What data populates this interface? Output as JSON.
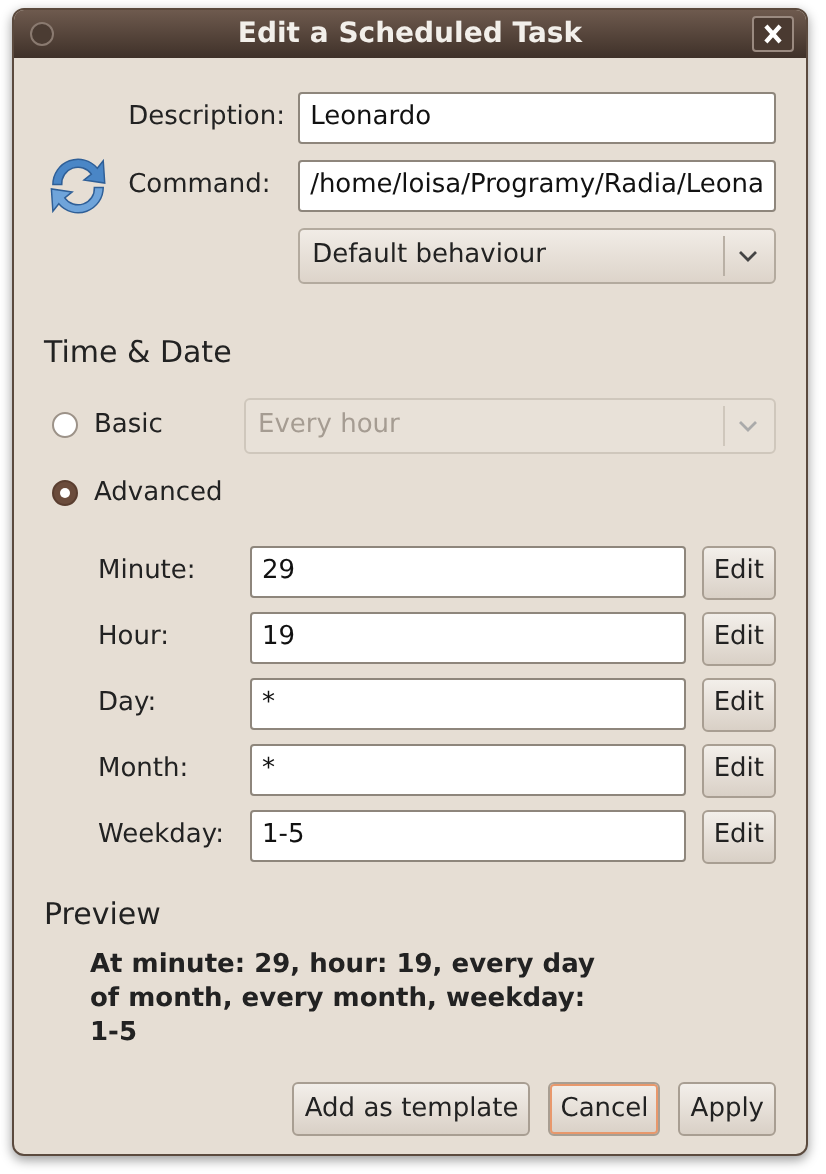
{
  "window": {
    "title": "Edit a Scheduled Task"
  },
  "task": {
    "description_label": "Description:",
    "description": "Leonardo",
    "command_label": "Command:",
    "command": "/home/loisa/Programy/Radia/Leona",
    "behaviour": "Default behaviour"
  },
  "time_date": {
    "heading": "Time & Date",
    "modes": [
      {
        "label": "Basic",
        "selected": false,
        "combo": "Every hour"
      },
      {
        "label": "Advanced",
        "selected": true
      }
    ],
    "fields": [
      {
        "label": "Minute:",
        "value": "29",
        "button": "Edit"
      },
      {
        "label": "Hour:",
        "value": "19",
        "button": "Edit"
      },
      {
        "label": "Day:",
        "value": "*",
        "button": "Edit"
      },
      {
        "label": "Month:",
        "value": "*",
        "button": "Edit"
      },
      {
        "label": "Weekday:",
        "value": "1-5",
        "button": "Edit"
      }
    ]
  },
  "preview": {
    "heading": "Preview",
    "text": "At minute: 29, hour: 19, every day of month, every month, weekday: 1-5"
  },
  "buttons": [
    {
      "label": "Add as template",
      "focused": false
    },
    {
      "label": "Cancel",
      "focused": true
    },
    {
      "label": "Apply",
      "focused": false
    }
  ]
}
